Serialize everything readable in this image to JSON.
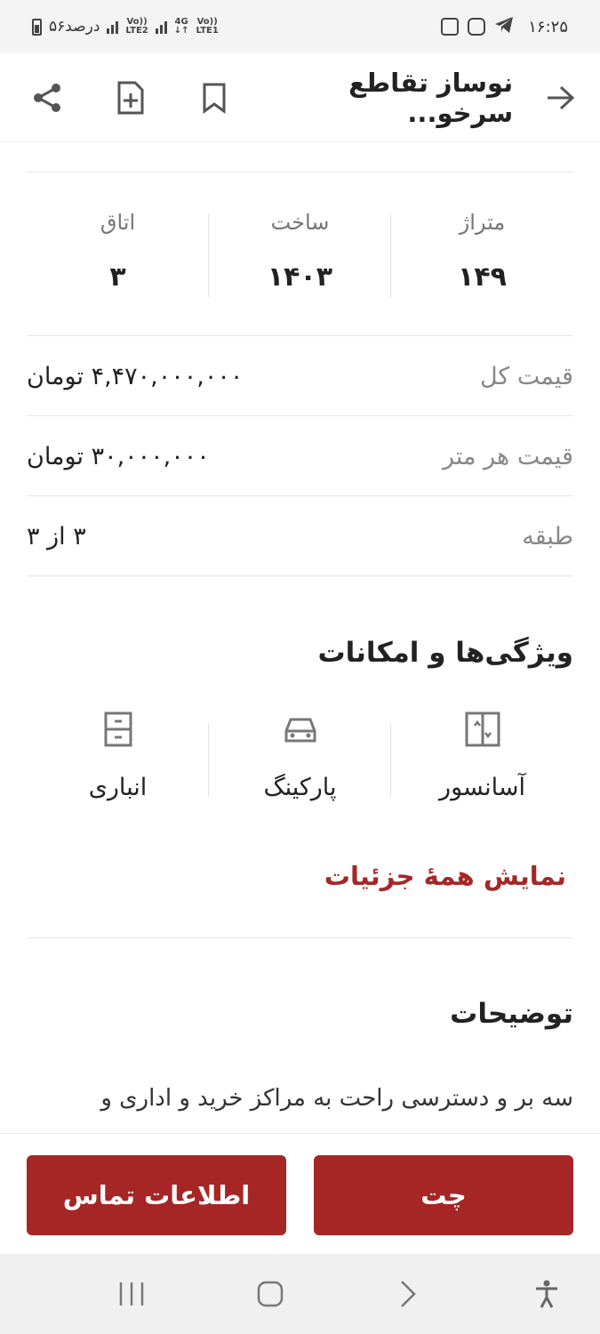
{
  "status_bar": {
    "time": "۱۶:۲۵",
    "battery_text": "۵۶درصد",
    "sim2_label": "LTE2",
    "sim1_label": "LTE1",
    "network_type": "4G"
  },
  "header": {
    "title": "نوساز تقاطع سرخو..."
  },
  "stats": [
    {
      "label": "متراژ",
      "value": "۱۴۹"
    },
    {
      "label": "ساخت",
      "value": "۱۴۰۳"
    },
    {
      "label": "اتاق",
      "value": "۳"
    }
  ],
  "details": [
    {
      "label": "قیمت کل",
      "value": "۴,۴۷۰,۰۰۰,۰۰۰ تومان"
    },
    {
      "label": "قیمت هر متر",
      "value": "۳۰,۰۰۰,۰۰۰ تومان"
    },
    {
      "label": "طبقه",
      "value": "۳ از ۳"
    }
  ],
  "features_section": {
    "title": "ویژگی‌ها و امکانات",
    "items": [
      {
        "label": "آسانسور",
        "icon": "elevator-icon"
      },
      {
        "label": "پارکینگ",
        "icon": "car-icon"
      },
      {
        "label": "انباری",
        "icon": "storage-icon"
      }
    ],
    "show_all_label": "نمایش همهٔ جزئیات"
  },
  "description": {
    "title": "توضیحات",
    "text": "سه بر و دسترسی راحت به مراکز خرید و اداری و"
  },
  "actions": {
    "chat_label": "چت",
    "contact_label": "اطلاعات تماس"
  },
  "colors": {
    "accent": "#a62626",
    "text": "#222222",
    "muted": "#888888"
  }
}
